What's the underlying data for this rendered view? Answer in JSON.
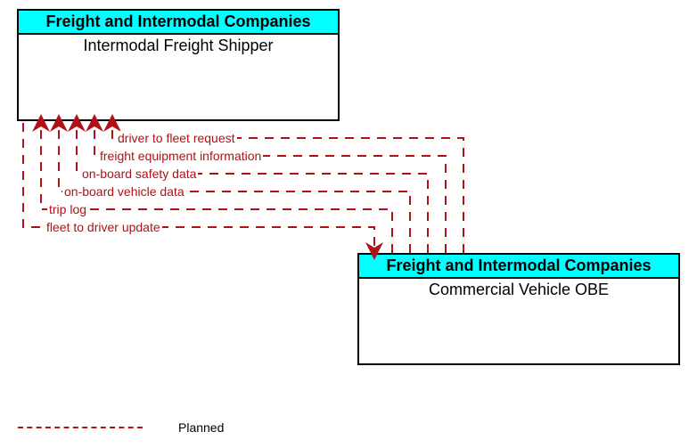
{
  "entities": {
    "top": {
      "header": "Freight and Intermodal Companies",
      "body": "Intermodal Freight Shipper"
    },
    "bottom": {
      "header": "Freight and Intermodal Companies",
      "body": "Commercial Vehicle OBE"
    }
  },
  "flows": [
    {
      "label": "driver to fleet request"
    },
    {
      "label": "freight equipment information"
    },
    {
      "label": "on-board safety data"
    },
    {
      "label": "on-board vehicle data"
    },
    {
      "label": "trip log"
    },
    {
      "label": "fleet to driver update"
    }
  ],
  "legend": {
    "planned": "Planned"
  },
  "chart_data": {
    "type": "diagram",
    "nodes": [
      {
        "id": "intermodal-freight-shipper",
        "group": "Freight and Intermodal Companies",
        "label": "Intermodal Freight Shipper"
      },
      {
        "id": "commercial-vehicle-obe",
        "group": "Freight and Intermodal Companies",
        "label": "Commercial Vehicle OBE"
      }
    ],
    "edges": [
      {
        "from": "commercial-vehicle-obe",
        "to": "intermodal-freight-shipper",
        "label": "driver to fleet request",
        "status": "Planned"
      },
      {
        "from": "commercial-vehicle-obe",
        "to": "intermodal-freight-shipper",
        "label": "freight equipment information",
        "status": "Planned"
      },
      {
        "from": "commercial-vehicle-obe",
        "to": "intermodal-freight-shipper",
        "label": "on-board safety data",
        "status": "Planned"
      },
      {
        "from": "commercial-vehicle-obe",
        "to": "intermodal-freight-shipper",
        "label": "on-board vehicle data",
        "status": "Planned"
      },
      {
        "from": "commercial-vehicle-obe",
        "to": "intermodal-freight-shipper",
        "label": "trip log",
        "status": "Planned"
      },
      {
        "from": "intermodal-freight-shipper",
        "to": "commercial-vehicle-obe",
        "label": "fleet to driver update",
        "status": "Planned"
      }
    ],
    "legend": [
      {
        "style": "dashed",
        "color": "#b11117",
        "label": "Planned"
      }
    ]
  }
}
